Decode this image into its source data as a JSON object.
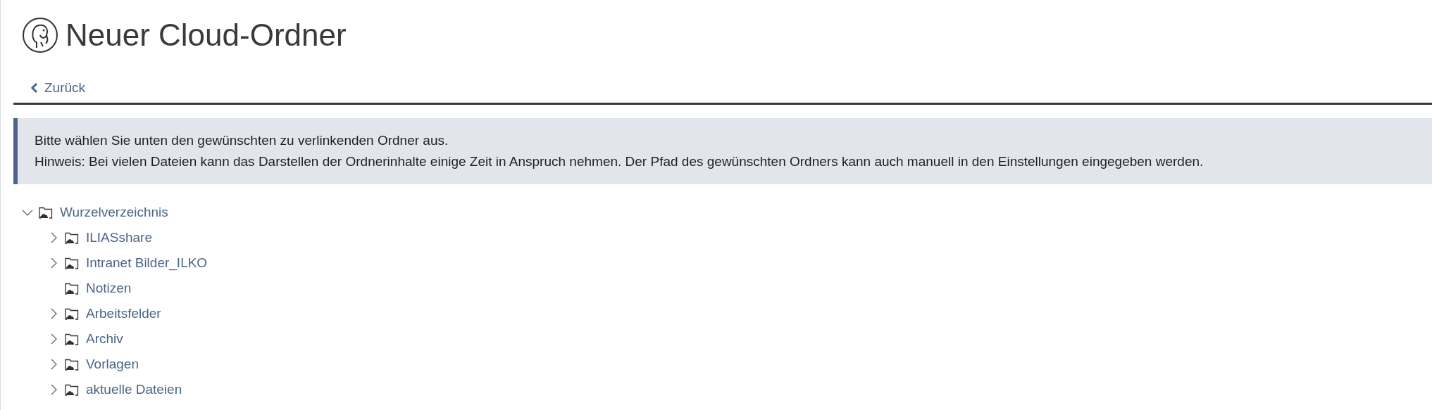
{
  "header": {
    "title": "Neuer Cloud-Ordner"
  },
  "back_link": {
    "label": "Zurück"
  },
  "info_message": [
    "Bitte wählen Sie unten den gewünschten zu verlinkenden Ordner aus.",
    "Hinweis: Bei vielen Dateien kann das Darstellen der Ordnerinhalte einige Zeit in Anspruch nehmen. Der Pfad des gewünschten Ordners kann auch manuell in den Einstellungen eingegeben werden."
  ],
  "tree": [
    {
      "label": "Wurzelverzeichnis",
      "expandable": true,
      "expanded": true,
      "children": [
        {
          "label": "ILIASshare",
          "expandable": true,
          "expanded": false
        },
        {
          "label": "Intranet Bilder_ILKO",
          "expandable": true,
          "expanded": false
        },
        {
          "label": "Notizen",
          "expandable": false
        },
        {
          "label": "Arbeitsfelder",
          "expandable": true,
          "expanded": false
        },
        {
          "label": "Archiv",
          "expandable": true,
          "expanded": false
        },
        {
          "label": "Vorlagen",
          "expandable": true,
          "expanded": false
        },
        {
          "label": "aktuelle Dateien",
          "expandable": true,
          "expanded": false
        }
      ]
    }
  ]
}
